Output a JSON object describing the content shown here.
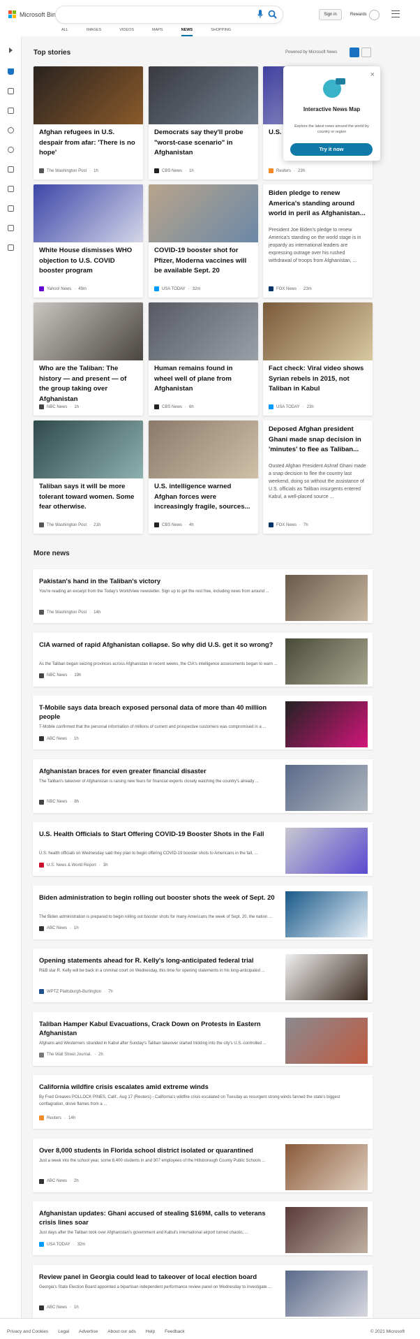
{
  "header": {
    "brand": "Microsoft Bing",
    "sign_in": "Sign in",
    "rewards": "Rewards"
  },
  "tabs": [
    "ALL",
    "IMAGES",
    "VIDEOS",
    "MAPS",
    "NEWS",
    "SHOPPING"
  ],
  "top_stories": {
    "title": "Top stories",
    "powered": "Powered by Microsoft News"
  },
  "popup": {
    "title": "Interactive News Map",
    "desc": "Explore the latest news around the world by country or region",
    "button": "Try it now"
  },
  "cards": [
    {
      "title": "Afghan refugees in U.S. despair from afar: 'There is no hope'",
      "source": "The Washington Post",
      "time": "1h",
      "img": [
        "#2a2320",
        "#8a5a2a"
      ]
    },
    {
      "title": "Democrats say they'll probe \"worst-case scenario\" in Afghanistan",
      "source": "CBS News",
      "time": "1h",
      "img": [
        "#3a3a40",
        "#6f7d8c"
      ]
    },
    {
      "title": "U.S. … of Ka… staff",
      "source": "Reuters",
      "time": "23h",
      "img": [
        "#3f3fa0",
        "#c0c0d8"
      ]
    },
    {
      "title": "White House dismisses WHO objection to U.S. COVID booster program",
      "source": "Yahoo! News",
      "time": "49m",
      "img": [
        "#3c47a8",
        "#d5d6e8"
      ]
    },
    {
      "title": "COVID-19 booster shot for Pfizer, Moderna vaccines will be available Sept. 20",
      "source": "USA TODAY",
      "time": "32m",
      "img": [
        "#b8a48a",
        "#6b88a8"
      ]
    },
    {
      "title": "Biden pledge to renew America's standing around world in peril as Afghanistan...",
      "desc": "President Joe Biden's pledge to renew America's standing on the world stage is in jeopardy as international leaders are expressing outrage over his rushed withdrawal of troops from Afghanistan, ...",
      "source": "FOX News",
      "time": "23m"
    },
    {
      "title": "Who are the Taliban: The history — and present — of the group taking over Afghanistan",
      "source": "NBC News",
      "time": "1h",
      "img": [
        "#c9c5c0",
        "#4a4540"
      ]
    },
    {
      "title": "Human remains found in wheel well of plane from Afghanistan",
      "source": "CBS News",
      "time": "6h",
      "img": [
        "#575a63",
        "#9aa0a8"
      ]
    },
    {
      "title": "Fact check: Viral video shows Syrian rebels in 2015, not Taliban in Kabul",
      "source": "USA TODAY",
      "time": "23h",
      "img": [
        "#7a5a3a",
        "#d8c8a0"
      ]
    },
    {
      "title": "Taliban says it will be more tolerant toward women. Some fear otherwise.",
      "source": "The Washington Post",
      "time": "21h",
      "img": [
        "#2f4a4a",
        "#8fb0b0"
      ]
    },
    {
      "title": "U.S. intelligence warned Afghan forces were increasingly fragile, sources...",
      "source": "CBS News",
      "time": "4h",
      "img": [
        "#8a7a6a",
        "#d0c0a8"
      ]
    },
    {
      "title": "Deposed Afghan president Ghani made snap decision in 'minutes' to flee as Taliban...",
      "desc": "Ousted Afghan President Ashraf Ghani made a snap decision to flee the country last weekend, doing so without the assistance of U.S. officials as Taliban insurgents entered Kabul, a well-placed source ...",
      "source": "FOX News",
      "time": "7h"
    }
  ],
  "more_news": {
    "title": "More news",
    "items": [
      {
        "title": "Pakistan's hand in the Taliban's victory",
        "desc": "You're reading an excerpt from the Today's WorldView newsletter. Sign up to get the rest free, including news from around ...",
        "source": "The Washington Post",
        "time": "14h",
        "img": [
          "#6a5a4a",
          "#c8b8a0"
        ]
      },
      {
        "title": "CIA warned of rapid Afghanistan collapse. So why did U.S. get it so wrong?",
        "desc": "As the Taliban began seizing provinces across Afghanistan in recent weeks, the CIA's intelligence assessments began to warn ...",
        "source": "NBC News",
        "time": "19h",
        "img": [
          "#4a4a3a",
          "#a8a890"
        ]
      },
      {
        "title": "T-Mobile says data breach exposed personal data of more than 40 million people",
        "desc": "T-Mobile confirmed that the personal information of millions of current and prospective customers was compromised in a ...",
        "source": "ABC News",
        "time": "1h",
        "img": [
          "#222",
          "#d2157a"
        ]
      },
      {
        "title": "Afghanistan braces for even greater financial disaster",
        "desc": "The Taliban's takeover of Afghanistan is raising new fears for financial experts closely watching the country's already ...",
        "source": "NBC News",
        "time": "8h",
        "img": [
          "#5a6a8a",
          "#b0b8c0"
        ]
      },
      {
        "title": "U.S. Health Officials to Start Offering COVID-19 Booster Shots in the Fall",
        "desc": "U.S. health officials on Wednesday said they plan to begin offering COVID-19 booster shots to Americans in the fall, ...",
        "source": "U.S. News & World Report",
        "time": "3h",
        "img": [
          "#c8c8d0",
          "#5a4ad0"
        ]
      },
      {
        "title": "Biden administration to begin rolling out booster shots the week of Sept. 20",
        "desc": "The Biden administration is prepared to begin rolling out booster shots for many Americans the week of Sept. 20, the nation ...",
        "source": "ABC News",
        "time": "1h",
        "img": [
          "#1a5a8a",
          "#e8f0f8"
        ]
      },
      {
        "title": "Opening statements ahead for R. Kelly's long-anticipated federal trial",
        "desc": "R&B star R. Kelly will be back in a criminal court on Wednesday, this time for opening statements in his long-anticipated ...",
        "source": "WPTZ Plattsburgh-Burlington",
        "time": "7h",
        "img": [
          "#f0f0f0",
          "#3a2a20"
        ]
      },
      {
        "title": "Taliban Hamper Kabul Evacuations, Crack Down on Protests in Eastern Afghanistan",
        "desc": "Afghans and Westerners stranded in Kabul after Sunday's Taliban takeover started trickling into the city's U.S.-controlled ...",
        "source": "The Wall Street Journal.",
        "time": "2h",
        "img": [
          "#8a8a90",
          "#c05a40"
        ]
      },
      {
        "title": "California wildfire crisis escalates amid extreme winds",
        "desc": "By Fred Greaves POLLOCK PINES, Calif., Aug 17 (Reuters) - California's wildfire crisis escalated on Tuesday as resurgent strong winds fanned the state's biggest conflagration, drove flames from a ...",
        "source": "Reuters",
        "time": "14h"
      },
      {
        "title": "Over 8,000 students in Florida school district isolated or quarantined",
        "desc": "Just a week into the school year, some 8,400 students in and 307 employees of the Hillsborough County Public Schools ...",
        "source": "ABC News",
        "time": "2h",
        "img": [
          "#8a5a3a",
          "#e0d0c0"
        ]
      },
      {
        "title": "Afghanistan updates: Ghani accused of stealing $169M, calls to veterans crisis lines soar",
        "desc": "Just days after the Taliban took over Afghanistan's government and Kabul's international airport turned chaotic, ...",
        "source": "USA TODAY",
        "time": "32m",
        "img": [
          "#5a3a3a",
          "#c0b0a0"
        ]
      },
      {
        "title": "Review panel in Georgia could lead to takeover of local election board",
        "desc": "Georgia's State Election Board appointed a bipartisan independent performance review panel on Wednesday to investigate ...",
        "source": "ABC News",
        "time": "1h",
        "img": [
          "#5a6a8a",
          "#d8d8e0"
        ]
      }
    ]
  },
  "footer": {
    "links": [
      "Privacy and Cookies",
      "Legal",
      "Advertise",
      "About our ads",
      "Help",
      "Feedback"
    ],
    "copyright": "© 2021 Microsoft"
  },
  "colors": {
    "accent": "#0f7aa8",
    "brand_blue": "#1a73c2"
  },
  "icons": [
    "microsoft-logo-icon",
    "microphone-icon",
    "search-icon",
    "trophy-icon",
    "hamburger-menu-icon",
    "expand-icon",
    "home-icon",
    "rail-icons",
    "close-icon",
    "globe-map-icon"
  ]
}
